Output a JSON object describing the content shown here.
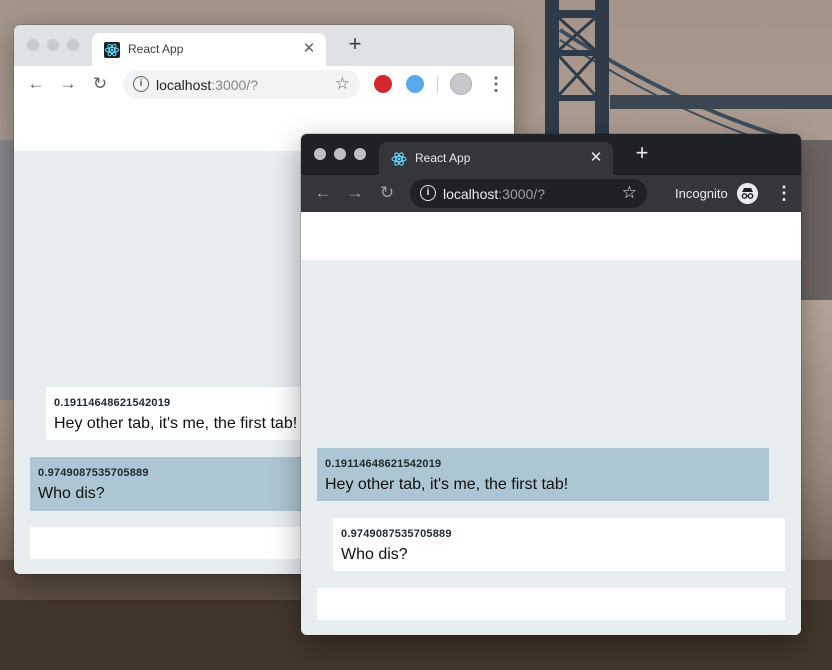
{
  "window1": {
    "tab_title": "React App",
    "tab_close": "✕",
    "new_tab": "+",
    "url_host": "localhost",
    "url_path": ":3000/?",
    "messages": [
      {
        "id": "0.19114648621542019",
        "text": "Hey other tab, it's me, the first tab!"
      },
      {
        "id": "0.9749087535705889",
        "text": "Who dis?"
      }
    ]
  },
  "window2": {
    "tab_title": "React App",
    "tab_close": "✕",
    "new_tab": "+",
    "url_host": "localhost",
    "url_path": ":3000/?",
    "incognito_label": "Incognito",
    "messages": [
      {
        "id": "0.19114648621542019",
        "text": "Hey other tab, it's me, the first tab!"
      },
      {
        "id": "0.9749087535705889",
        "text": "Who dis?"
      }
    ]
  },
  "icons": {
    "back": "←",
    "forward": "→",
    "reload": "↻",
    "info": "i",
    "star": "☆",
    "menu": "⋮"
  },
  "colors": {
    "own_message_bg": "#adc6d3",
    "other_message_bg": "#ffffff",
    "page_bg": "#e8edf0",
    "incognito_chrome": "#202124"
  }
}
